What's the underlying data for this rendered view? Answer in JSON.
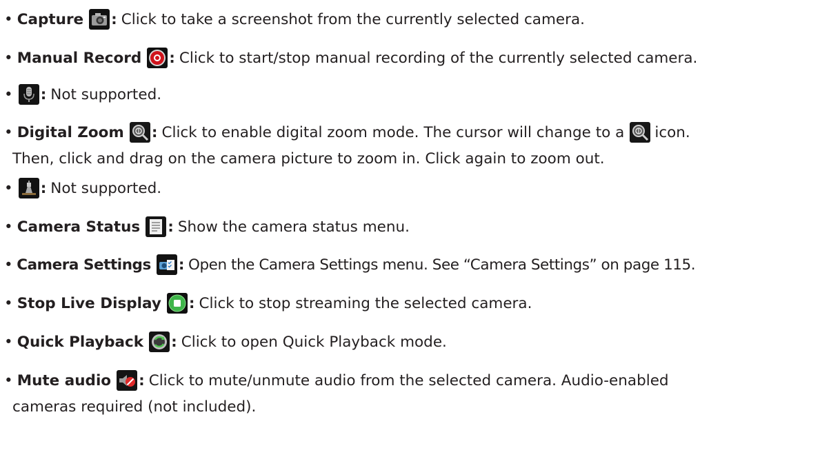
{
  "items": [
    {
      "title": "Capture",
      "text": "Click to take a screenshot from the currently selected camera.",
      "icon": "camera-capture-icon"
    },
    {
      "title": "Manual Record",
      "text": "Click to start/stop manual recording of the currently selected camera.",
      "icon": "record-icon"
    },
    {
      "text": "Not supported.",
      "icon": "microphone-icon"
    },
    {
      "title": "Digital Zoom",
      "text": "Click to enable digital zoom mode. The cursor will change to a",
      "text_after_icon": "icon.",
      "continuation": "Then, click and drag on the camera picture to zoom in. Click again to zoom out.",
      "icon": "digital-zoom-icon"
    },
    {
      "text": "Not supported.",
      "icon": "ptz-icon"
    },
    {
      "title": "Camera Status",
      "text": "Show the camera status menu.",
      "icon": "document-list-icon"
    },
    {
      "title": "Camera Settings",
      "text": "Open the Camera Settings menu. See “Camera Settings” on page 115.",
      "icon": "camera-settings-icon"
    },
    {
      "title": "Stop Live Display",
      "text": "Click to stop streaming the selected camera.",
      "icon": "stop-icon"
    },
    {
      "title": "Quick Playback",
      "text": "Click to open Quick Playback mode.",
      "icon": "quick-playback-icon"
    },
    {
      "title": "Mute audio",
      "text": "Click to mute/unmute audio from the selected camera. Audio-enabled",
      "continuation": "cameras required (not included).",
      "icon": "mute-audio-icon"
    }
  ],
  "bullet": "•",
  "colon": ":"
}
